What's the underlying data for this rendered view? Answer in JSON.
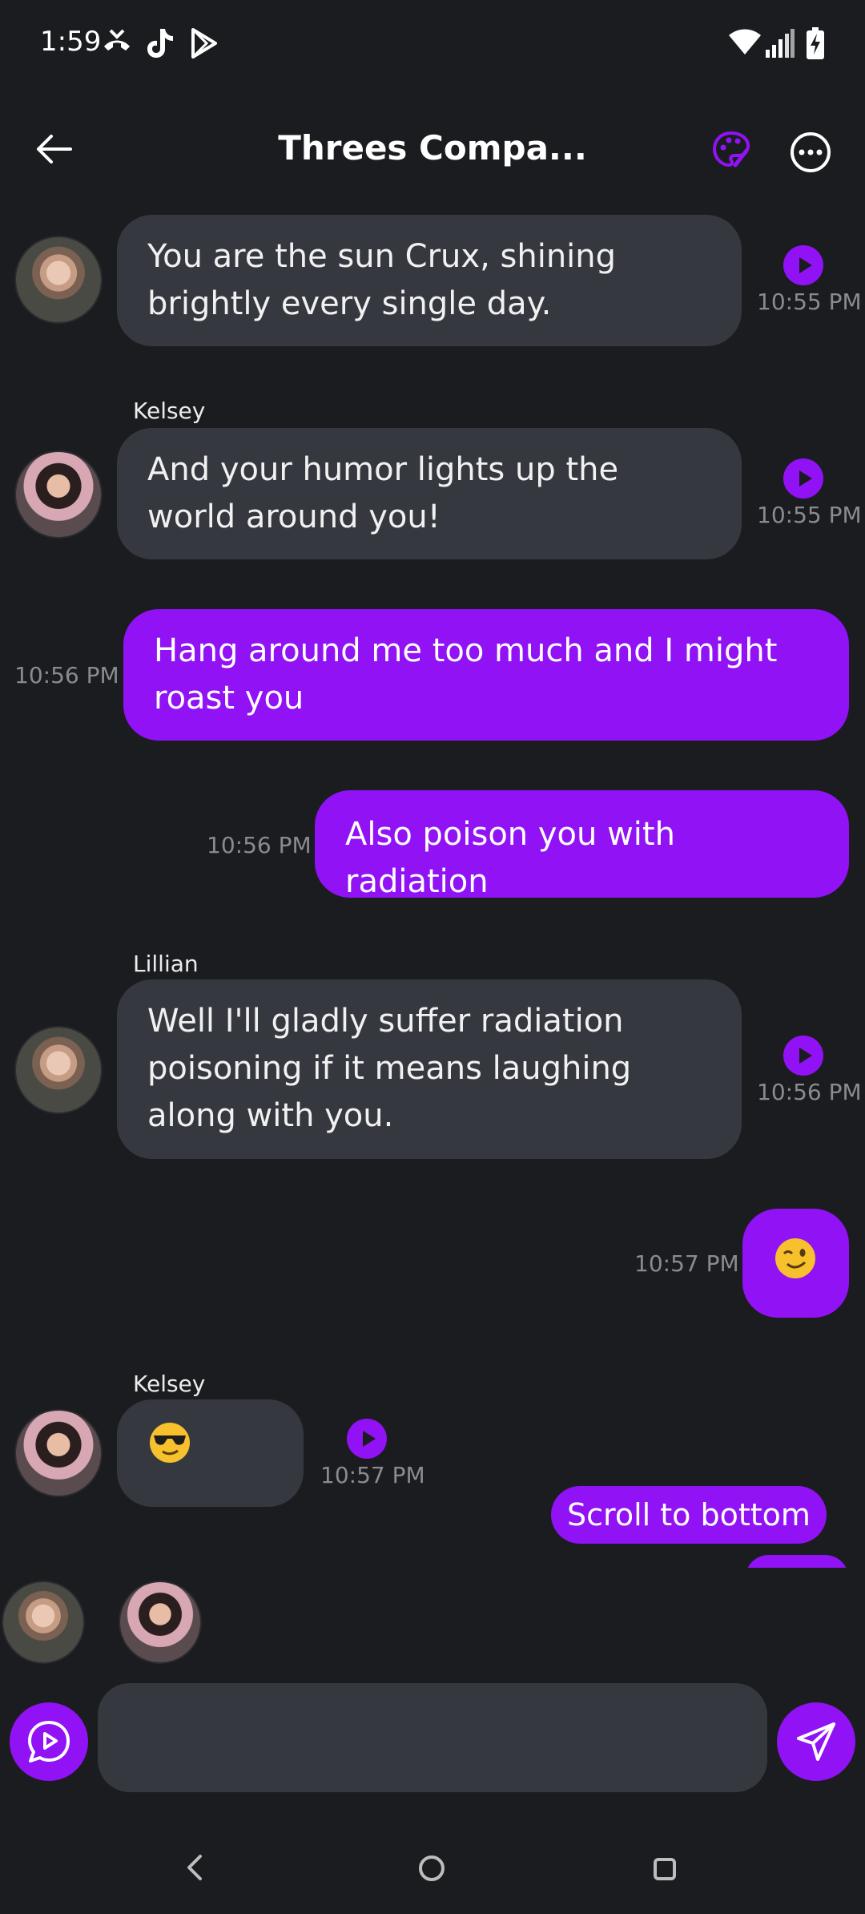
{
  "status_bar": {
    "time": "1:59"
  },
  "header": {
    "title": "Threes Compa..."
  },
  "messages": [
    {
      "text": "You are the sun Crux, shining brightly every single day.",
      "time": "10:55 PM"
    },
    {
      "sender": "Kelsey",
      "text": "And your humor lights up the world around you!",
      "time": "10:55 PM"
    },
    {
      "text": "Hang around me too much and I might roast you",
      "time": "10:56 PM"
    },
    {
      "text": "Also poison you with radiation",
      "time": "10:56 PM"
    },
    {
      "sender": "Lillian",
      "text": "Well I'll gladly suffer radiation poisoning if it means laughing along with you.",
      "time": "10:56 PM"
    },
    {
      "emoji": "wink-emoji",
      "time": "10:57 PM"
    },
    {
      "sender": "Kelsey",
      "emoji": "sunglasses-emoji",
      "time": "10:57 PM"
    }
  ],
  "scroll_to_bottom_label": "Scroll to bottom",
  "colors": {
    "accent": "#9112f5",
    "background": "#1b1c20",
    "incoming_bubble": "#363840"
  }
}
